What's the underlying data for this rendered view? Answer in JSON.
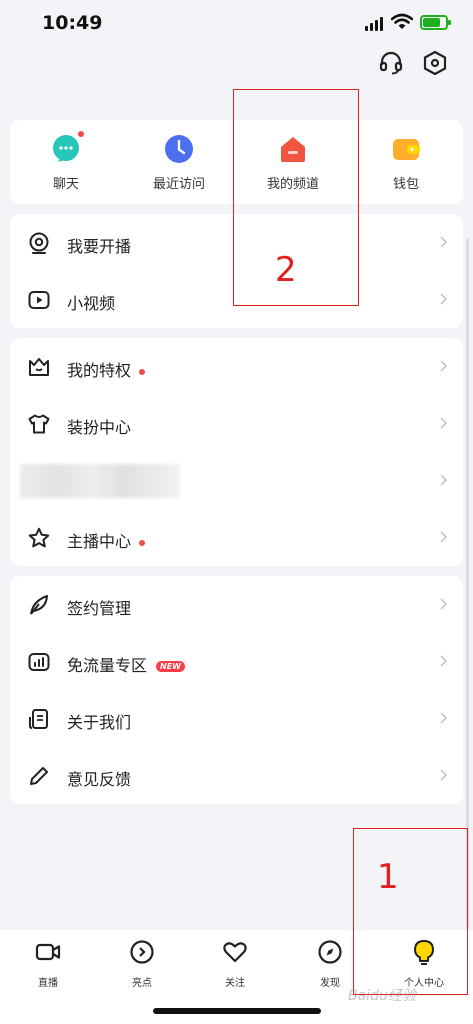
{
  "status_bar": {
    "time": "10:49"
  },
  "quick_access": [
    {
      "label": "聊天",
      "icon": "chat-icon"
    },
    {
      "label": "最近访问",
      "icon": "clock-icon"
    },
    {
      "label": "我的频道",
      "icon": "house-icon"
    },
    {
      "label": "钱包",
      "icon": "wallet-icon"
    }
  ],
  "menu_group_1": [
    {
      "label": "我要开播",
      "icon": "broadcast-icon"
    },
    {
      "label": "小视频",
      "icon": "video-play-icon"
    }
  ],
  "menu_group_2": [
    {
      "label": "我的特权",
      "icon": "crown-icon",
      "dot": true
    },
    {
      "label": "装扮中心",
      "icon": "tshirt-icon"
    },
    {
      "label": "",
      "icon": "blurred-item"
    },
    {
      "label": "主播中心",
      "icon": "star-icon",
      "dot": true
    }
  ],
  "menu_group_3": [
    {
      "label": "签约管理",
      "icon": "feather-icon"
    },
    {
      "label": "免流量专区",
      "icon": "data-chart-icon",
      "badge": "NEW"
    },
    {
      "label": "关于我们",
      "icon": "document-icon"
    },
    {
      "label": "意见反馈",
      "icon": "pencil-icon"
    }
  ],
  "bottom_nav": [
    {
      "label": "直播",
      "icon": "camera-icon"
    },
    {
      "label": "亮点",
      "icon": "highlight-icon"
    },
    {
      "label": "关注",
      "icon": "heart-icon"
    },
    {
      "label": "发现",
      "icon": "compass-icon"
    },
    {
      "label": "个人中心",
      "icon": "profile-bulb-icon",
      "active": true
    }
  ],
  "annotations": {
    "box1_number": "1",
    "box2_number": "2"
  },
  "watermark": "Baidu经验",
  "colors": {
    "accent_yellow": "#ffd600",
    "annotation_red": "#e02020",
    "dot_red": "#f04a4a",
    "chat_teal": "#27c6b9",
    "clock_blue": "#4c6ef0",
    "channel_red": "#f2553f",
    "wallet_orange": "#ffae2b"
  }
}
